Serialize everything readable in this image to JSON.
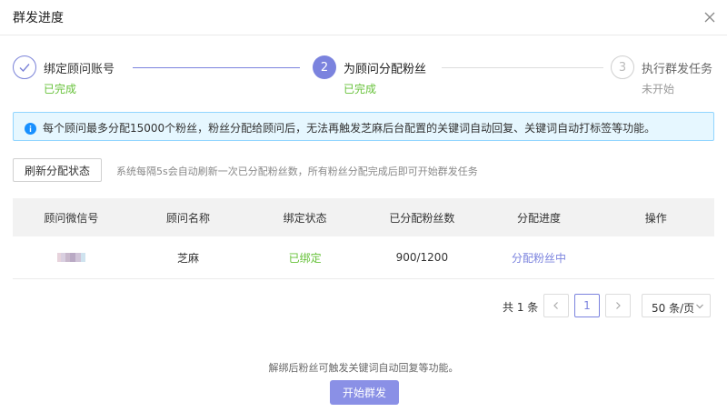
{
  "dialog": {
    "title": "群发进度"
  },
  "steps": [
    {
      "number": "",
      "label": "绑定顾问账号",
      "status": "已完成"
    },
    {
      "number": "2",
      "label": "为顾问分配粉丝",
      "status": "已完成"
    },
    {
      "number": "3",
      "label": "执行群发任务",
      "status": "未开始"
    }
  ],
  "info": {
    "text": "每个顾问最多分配15000个粉丝，粉丝分配给顾问后，无法再触发芝麻后台配置的关键词自动回复、关键词自动打标签等功能。"
  },
  "refresh": {
    "button_label": "刷新分配状态",
    "hint": "系统每隔5s会自动刷新一次已分配粉丝数，所有粉丝分配完成后即可开始群发任务"
  },
  "table": {
    "headers": [
      "顾问微信号",
      "顾问名称",
      "绑定状态",
      "已分配粉丝数",
      "分配进度",
      "操作"
    ],
    "rows": [
      {
        "wechat_id": "",
        "name": "芝麻",
        "bind_status": "已绑定",
        "assigned": "900/1200",
        "progress": "分配粉丝中",
        "action": ""
      }
    ]
  },
  "pagination": {
    "total": "共 1 条",
    "current_page": "1",
    "page_size": "50 条/页"
  },
  "footer": {
    "hint": "解绑后粉丝可触发关键词自动回复等功能。",
    "start_button": "开始群发"
  },
  "colors": {
    "primary": "#7b83de",
    "success": "#67c23a",
    "info_bg": "#e6f7ff",
    "info_border": "#91d5ff"
  }
}
